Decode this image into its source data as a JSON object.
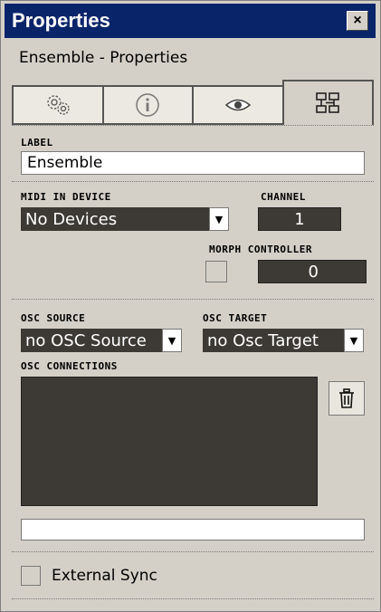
{
  "window": {
    "title": "Properties",
    "close_glyph": "×"
  },
  "subtitle": "Ensemble - Properties",
  "tabs": [
    {
      "icon": "gears-icon",
      "active": false
    },
    {
      "icon": "info-icon",
      "active": false
    },
    {
      "icon": "eye-icon",
      "active": false
    },
    {
      "icon": "connections-icon",
      "active": true
    }
  ],
  "label_section": {
    "heading": "LABEL",
    "value": "Ensemble"
  },
  "midi": {
    "device_heading": "MIDI IN DEVICE",
    "device_value": "No Devices",
    "channel_heading": "CHANNEL",
    "channel_value": "1",
    "morph_heading": "MORPH CONTROLLER",
    "morph_value": "0"
  },
  "osc": {
    "source_heading": "OSC SOURCE",
    "source_value": "no OSC Source",
    "target_heading": "OSC TARGET",
    "target_value": "no Osc Target",
    "connections_heading": "OSC CONNECTIONS",
    "connections_input_value": ""
  },
  "sync": {
    "label": "External Sync",
    "checked": false
  },
  "colors": {
    "titlebar": "#0a246a",
    "dark_field": "#3d3a36",
    "panel": "#d4d0c8"
  }
}
